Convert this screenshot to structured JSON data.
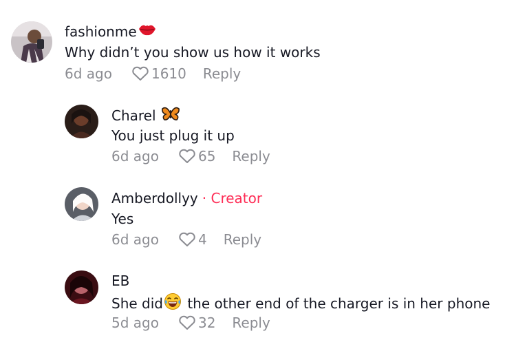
{
  "comments": [
    {
      "username": "fashionme",
      "username_emoji": "lips-icon",
      "text": "Why didn’t you show us how it works",
      "time": "6d ago",
      "likes": "1610",
      "reply_label": "Reply"
    },
    {
      "username": "Charel",
      "username_emoji": "butterfly-icon",
      "text": "You just plug it up",
      "time": "6d ago",
      "likes": "65",
      "reply_label": "Reply"
    },
    {
      "username": "Amberdollyy",
      "creator_label": "· Creator",
      "text": "Yes",
      "time": "6d ago",
      "likes": "4",
      "reply_label": "Reply"
    },
    {
      "username": "EB",
      "text_before_emoji": "She did",
      "text_emoji": "laughing-emoji-icon",
      "text_after_emoji": " the other end of the charger is in her phone",
      "time": "5d ago",
      "likes": "32",
      "reply_label": "Reply"
    }
  ],
  "colors": {
    "creator_accent": "#fe2c55",
    "primary_text": "#161823",
    "secondary_text": "#8a8b91"
  }
}
